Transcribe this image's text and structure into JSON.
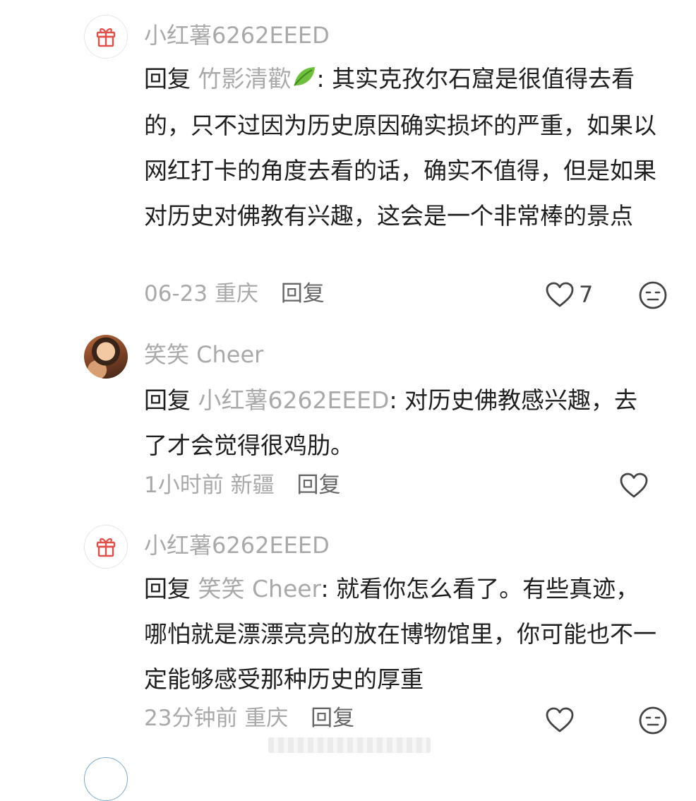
{
  "comments": [
    {
      "username": "小红薯6262EEED",
      "avatar": "gift-icon",
      "reply_prefix": "回复 ",
      "reply_target": "竹影清歡",
      "reply_target_icon": "leaf-icon",
      "text": ": 其实克孜尔石窟是很值得去看的，只不过因为历史原因确实损坏的严重，如果以网红打卡的角度去看的话，确实不值得，但是如果对历史对佛教有兴趣，这会是一个非常棒的景点",
      "time": "06-23",
      "location": "重庆",
      "reply_label": "回复",
      "like_count": "7"
    },
    {
      "username": "笑笑 Cheer",
      "avatar": "user-photo",
      "reply_prefix": "回复 ",
      "reply_target": "小红薯6262EEED",
      "text": ": 对历史佛教感兴趣，去了才会觉得很鸡肋。",
      "time": "1小时前",
      "location": "新疆",
      "reply_label": "回复",
      "like_count": ""
    },
    {
      "username": "小红薯6262EEED",
      "avatar": "gift-icon",
      "reply_prefix": "回复 ",
      "reply_target": "笑笑 Cheer",
      "text": ": 就看你怎么看了。有些真迹，哪怕就是漂漂亮亮的放在博物馆里，你可能也不一定能够感受那种历史的厚重",
      "time": "23分钟前",
      "location": "重庆",
      "reply_label": "回复",
      "like_count": ""
    }
  ],
  "colors": {
    "text": "#1f1f1f",
    "muted": "#a9a9a9",
    "icon": "#444444",
    "gift": "#e0504a"
  }
}
